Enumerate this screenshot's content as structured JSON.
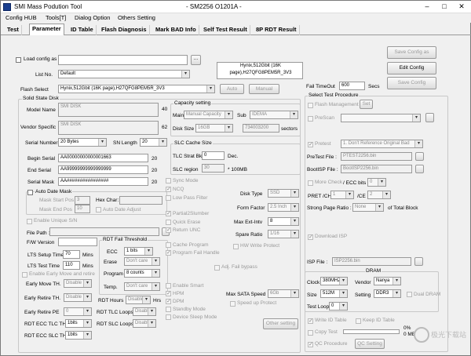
{
  "window": {
    "title": "SMI Mass Podution Tool",
    "subtitle": "- SM2256 O1201A -",
    "minimize": "–",
    "maximize": "□",
    "close": "✕"
  },
  "menu": [
    "Config HUB",
    "Tools[T]",
    "Dialog Option",
    "Others Setting"
  ],
  "tabs": [
    "Test",
    "Parameter",
    "ID Table",
    "Flash Diagnosis",
    "Mark BAD Info",
    "Self Test Result",
    "8P RDT Result"
  ],
  "top": {
    "load_config": "Load config as",
    "list_no_label": "List No.",
    "list_no": "Default",
    "flash_select_label": "Flash Select",
    "flash_select": "Hynix,512Gbit (16K page),H27QFG8PEM5R_3V3",
    "flash_info": "Hynix,512Gbit (16K page),H27QFG8PEM5R_3V3",
    "auto": "Auto",
    "manual": "Manual",
    "save_config_as": "Save Config as",
    "edit_config": "Edit Config",
    "save_config": "Save Config",
    "browse": "..."
  },
  "ssd": {
    "group": "Solid State Disk",
    "model_name_label": "Model Name",
    "model_name": "SMI DISK",
    "model_len": "40",
    "vendor_label": "Vendor Specific",
    "vendor": "SMI DISK",
    "vendor_len": "62",
    "serial_label": "Serial Number",
    "serial": "20 Bytes",
    "sn_length_label": "SN Length",
    "sn_length": "20",
    "begin_serial_label": "Begin Serial",
    "begin_serial": "AA00000000000001663",
    "begin_len": "20",
    "end_serial_label": "End Serial",
    "end_serial": "AA99999999999999999",
    "end_len": "20",
    "serial_mask_label": "Serial Mask",
    "serial_mask": "AA################",
    "mask_len": "20",
    "auto_date_mask": "Auto Date Mask",
    "mask_start_pos_label": "Mask Start Pos",
    "mask_start_pos": "3",
    "mask_end_pos_label": "Mask End Pos",
    "mask_end_pos": "10",
    "hex_char_label": "Hex Char:",
    "auto_date_adjust": "Auto Date Adjust",
    "enable_unique": "Enable Unique S/N",
    "file_path": "File Path :",
    "fw_version": "F/W Version"
  },
  "capacity": {
    "group": "Capacity setting",
    "main_label": "Main",
    "main": "Manual Capacity",
    "sub_label": "Sub",
    "sub": "IDEMA",
    "disk_size_label": "Disk Size",
    "disk_size": "16GB",
    "sectors_value": "734003200",
    "sectors": "sectors"
  },
  "slc": {
    "group": "SLC Cache Size",
    "tlc_strat_label": "TLC Strat Bk",
    "tlc_strat": "0",
    "dec": "Dec.",
    "slc_region_label": "SLC region",
    "slc_region": "30",
    "mb": "* 100MB"
  },
  "opts_mid": [
    "Sync Mode",
    "NCQ",
    "Low Pass Filter",
    "Partial2Slumber",
    "Quick Erase",
    "Return UNC",
    "Cache Program",
    "Program Fail Handle"
  ],
  "mid": {
    "disk_type_label": "Disk Type",
    "disk_type": "SSD",
    "form_factor_label": "Form Factor",
    "form_factor": "2.5 Inch",
    "max_ext_label": "Max Ext-Intv",
    "max_ext": "8",
    "spare_ratio_label": "Spare Ratio",
    "spare_ratio": "1/16",
    "hw_write_protect": "HW Write Protect",
    "adj_fail_bypass": "Adj. Fail bypass",
    "enable_smart": "Enable Smart",
    "hpm": "HPM",
    "dpm": "DPM",
    "standby": "Standby Mode",
    "device_sleep": "Device Sleep Mode",
    "max_sata_label": "Max SATA Speed",
    "max_sata": "6Gb",
    "speed_up": "Speed up Protect",
    "other_setting": "Other setting"
  },
  "test": {
    "lts_setup_label": "LTS Setup Time",
    "lts_setup": "70",
    "lts_test_label": "LTS Test Time",
    "lts_test": "110",
    "mins": "Mins",
    "enable_early": "Enable Early Move and retire",
    "early_move_label": "Early Move TH.",
    "early_move": "Disable",
    "early_retire_label": "Early Retire TH.",
    "early_retire": "Disable",
    "early_retire_pe_label": "Early Retire PE",
    "early_retire_pe": "0",
    "rdt_tlc_label": "RDT ECC TLC TH",
    "rdt_tlc": "1bits",
    "rdt_slc_label": "RDT ECC SLC TH",
    "rdt_slc": "1bits"
  },
  "rdt": {
    "group": "RDT Fail Threshold",
    "ecc_label": "ECC",
    "ecc": "1 bits",
    "erase_label": "Erase",
    "erase": "Don't care",
    "program_label": "Program",
    "program": "8 counts",
    "temp_label": "Temp.",
    "temp": "Don't care",
    "rdt_hours_label": "RDT Hours",
    "rdt_hours": "Disable",
    "hrs": "Hrs",
    "tlc_loops_label": "RDT TLC Loops",
    "tlc_loops": "Disable",
    "slc_loops_label": "RDT SLC Loops",
    "slc_loops": "Disable"
  },
  "right": {
    "fail_timeout_label": "Fail TimeOut",
    "fail_timeout": "600",
    "secs": "Secs",
    "group": "Select Test Procedure",
    "flash_management": "Flash Management",
    "set": "Set",
    "prescan": "PreScan",
    "pretest": "Pretest",
    "pretest_value": "1. Don't Reference Original Bad",
    "pretest_file_label": "PreTest File :",
    "pretest_file": "PTEST2256.bin",
    "bootisp_file_label": "BootISP File :",
    "bootisp_file": "BootISP2256.bin",
    "more_check": "More Check",
    "ecc_bits_label": "/ ECC bits",
    "ecc_bits": "0",
    "pret_ch_label": "PRET /CH",
    "pret_ch": "1",
    "ce_label": "/CE",
    "ce": "2",
    "strong_page_label": "Strong Page Ratio :",
    "strong_page": "None",
    "of_total": "of Total Block",
    "download_isp": "Download ISP",
    "isp_file_label": "ISP File :",
    "isp_file": "ISP2256.bin",
    "dram_group": "DRAM",
    "clock_label": "Clock",
    "clock": "380MHZ",
    "vendor_label": "Vendor",
    "vendor": "Nanya",
    "size_label": "Size",
    "size": "512M",
    "setting_label": "Setting",
    "setting": "DDR3",
    "dual_dram": "Dual DRAM",
    "test_loop_label": "Test Loop",
    "test_loop": "0",
    "write_id_table": "Write ID Table",
    "keep_id_table": "Keep ID Table",
    "copy_test": "Copy Test",
    "qc_procedure": "QC Procedure",
    "qc_setting": "QC Setting",
    "pct": "0%",
    "mb": "0 MB"
  },
  "watermark": "极光下载站"
}
